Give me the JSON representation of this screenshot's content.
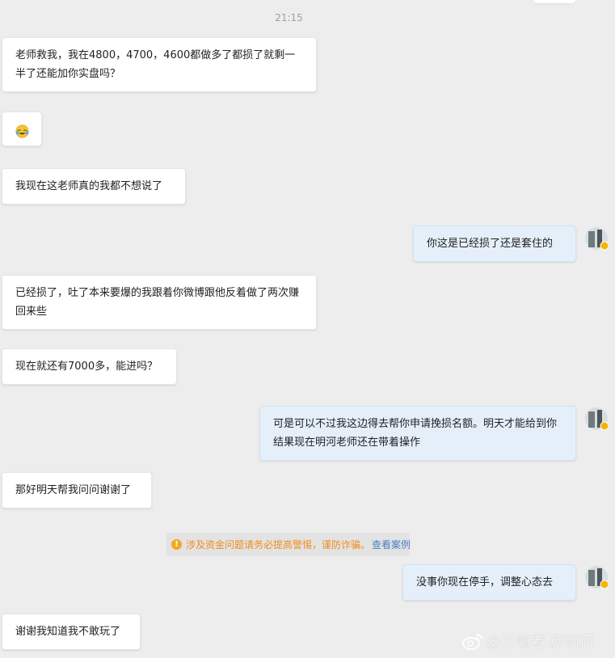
{
  "timestamp": "21:15",
  "messages": [
    {
      "side": "in",
      "text": "老师救我，我在4800，4700，4600都做多了都损了就剩一半了还能加你实盘吗？"
    },
    {
      "side": "in",
      "emoji": "face-with-tears-of-joy"
    },
    {
      "side": "in",
      "text": "我现在这老师真的我都不想说了"
    },
    {
      "side": "out",
      "text": "你这是已经损了还是套住的"
    },
    {
      "side": "in",
      "text": "已经损了，吐了本来要爆的我跟着你微博跟他反着做了两次赚回来些"
    },
    {
      "side": "in",
      "text": "现在就还有7000多，能进吗？"
    },
    {
      "side": "out",
      "text": "可是可以不过我这边得去帮你申请挽损名额。明天才能给到你结果现在明河老师还在带着操作"
    },
    {
      "side": "in",
      "text": "那好明天帮我问问谢谢了"
    },
    {
      "side": "out",
      "text": "没事你现在停手，调整心态去"
    },
    {
      "side": "in",
      "text": "谢谢我知道我不敢玩了"
    }
  ],
  "warning": {
    "icon": "exclamation-icon",
    "text": "涉及资金问题请务必提高警惕，谨防诈骗。",
    "link": "查看案例",
    "text_color": "#f08c1e",
    "link_color": "#4a7fbf"
  },
  "watermark": "@引领者-彦明河",
  "colors": {
    "background": "#ededed",
    "incoming_bubble": "#ffffff",
    "outgoing_bubble": "#e4effa"
  }
}
